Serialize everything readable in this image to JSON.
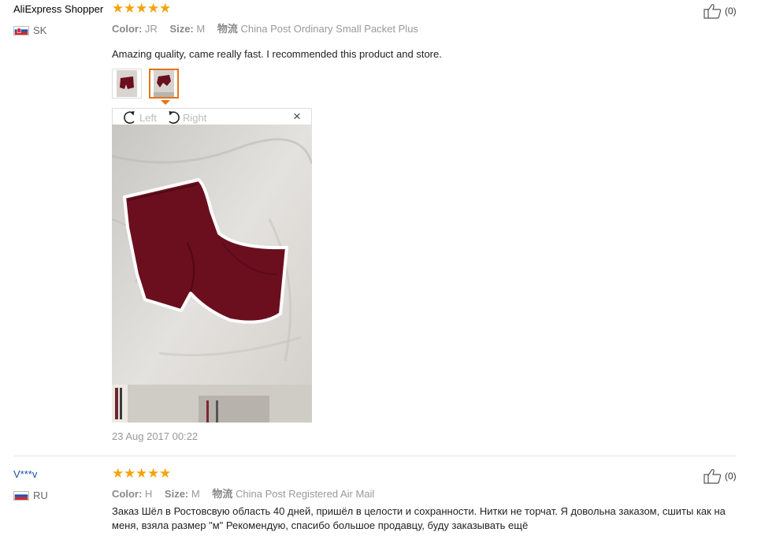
{
  "reviews": [
    {
      "user": "AliExpress Shopper",
      "country": "SK",
      "rating": 5,
      "color_label": "Color:",
      "color_value": "JR",
      "size_label": "Size:",
      "size_value": "M",
      "shipping_label": "物流",
      "shipping_value": "China Post Ordinary Small Packet Plus",
      "text": "Amazing quality, came really fast. I recommended this product and store.",
      "helpful": "(0)",
      "date": "23 Aug 2017 00:22"
    },
    {
      "user": "V***v",
      "country": "RU",
      "rating": 5,
      "color_label": "Color:",
      "color_value": "H",
      "size_label": "Size:",
      "size_value": "M",
      "shipping_label": "物流",
      "shipping_value": "China Post Registered Air Mail",
      "text": "Заказ Шёл в Ростовсвую область 40 дней, пришёл в целости и сохранности. Нитки не торчат. Я довольна заказом, сшиты как на меня, взяла размер \"м\" Рекомендую, спасибо большое продавцу, буду заказывать ещё",
      "helpful": "(0)"
    }
  ],
  "viewer": {
    "rotate_left": "Left",
    "rotate_right": "Right",
    "close": "×"
  },
  "colors": {
    "star": "#f5a30b",
    "active_thumb_border": "#e8731c",
    "shorts": "#6b0f1f"
  }
}
